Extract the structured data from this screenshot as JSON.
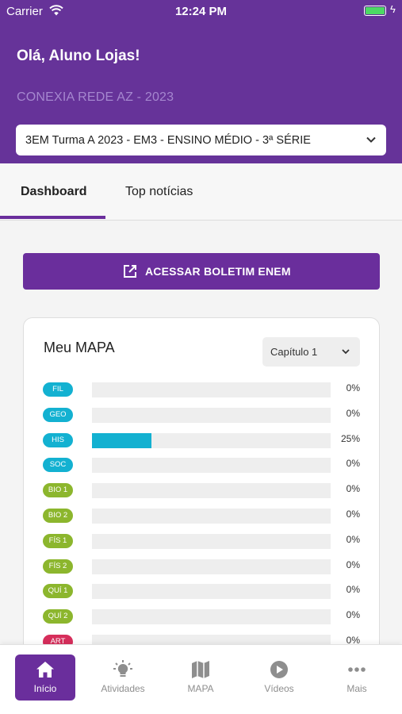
{
  "status_bar": {
    "carrier": "Carrier",
    "time": "12:24 PM"
  },
  "header": {
    "greeting": "Olá, Aluno Lojas!",
    "school": "CONEXIA REDE AZ - 2023",
    "class_select": "3EM Turma A 2023 - EM3 - ENSINO MÉDIO - 3ª SÉRIE"
  },
  "tabs": [
    {
      "label": "Dashboard",
      "active": true
    },
    {
      "label": "Top notícias",
      "active": false
    }
  ],
  "enem_button": {
    "label": "ACESSAR BOLETIM ENEM"
  },
  "mapa": {
    "title": "Meu MAPA",
    "chapter": "Capítulo 1",
    "subjects": [
      {
        "code": "FIL",
        "percent_label": "0%",
        "percent": 0,
        "color": "#13b1d1"
      },
      {
        "code": "GEO",
        "percent_label": "0%",
        "percent": 0,
        "color": "#13b1d1"
      },
      {
        "code": "HIS",
        "percent_label": "25%",
        "percent": 25,
        "color": "#13b1d1"
      },
      {
        "code": "SOC",
        "percent_label": "0%",
        "percent": 0,
        "color": "#13b1d1"
      },
      {
        "code": "BIO 1",
        "percent_label": "0%",
        "percent": 0,
        "color": "#8cb62d"
      },
      {
        "code": "BIO 2",
        "percent_label": "0%",
        "percent": 0,
        "color": "#8cb62d"
      },
      {
        "code": "FÍS 1",
        "percent_label": "0%",
        "percent": 0,
        "color": "#8cb62d"
      },
      {
        "code": "FÍS 2",
        "percent_label": "0%",
        "percent": 0,
        "color": "#8cb62d"
      },
      {
        "code": "QUÍ 1",
        "percent_label": "0%",
        "percent": 0,
        "color": "#8cb62d"
      },
      {
        "code": "QUÍ 2",
        "percent_label": "0%",
        "percent": 0,
        "color": "#8cb62d"
      },
      {
        "code": "ART",
        "percent_label": "0%",
        "percent": 0,
        "color": "#d62e5b"
      }
    ]
  },
  "bottom_nav": [
    {
      "label": "Início",
      "icon": "home-icon",
      "active": true
    },
    {
      "label": "Atividades",
      "icon": "lightbulb-icon",
      "active": false
    },
    {
      "label": "MAPA",
      "icon": "map-icon",
      "active": false
    },
    {
      "label": "Vídeos",
      "icon": "play-icon",
      "active": false
    },
    {
      "label": "Mais",
      "icon": "more-icon",
      "active": false
    }
  ],
  "colors": {
    "primary": "#663399",
    "accent": "#6a2e9c",
    "progress": "#13b1d1"
  }
}
